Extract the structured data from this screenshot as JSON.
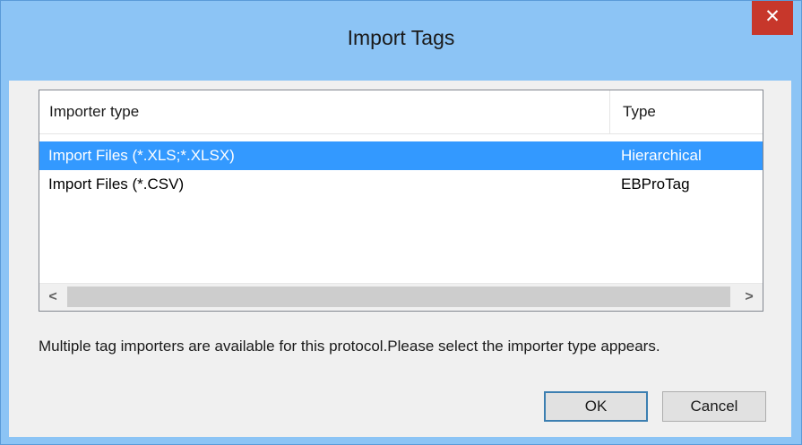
{
  "window": {
    "title": "Import Tags",
    "close_glyph": "✕"
  },
  "list": {
    "columns": [
      "Importer type",
      "Type"
    ],
    "rows": [
      {
        "importer": "Import Files (*.XLS;*.XLSX)",
        "type": "Hierarchical",
        "selected": true
      },
      {
        "importer": "Import Files (*.CSV)",
        "type": "EBProTag",
        "selected": false
      }
    ],
    "scroll_left_glyph": "<",
    "scroll_right_glyph": ">"
  },
  "message": "Multiple tag importers are available for this protocol.Please select the importer type appears.",
  "buttons": {
    "ok": "OK",
    "cancel": "Cancel"
  },
  "colors": {
    "title_bar": "#8cc4f5",
    "close_button": "#c7372b",
    "selection": "#3399ff"
  }
}
